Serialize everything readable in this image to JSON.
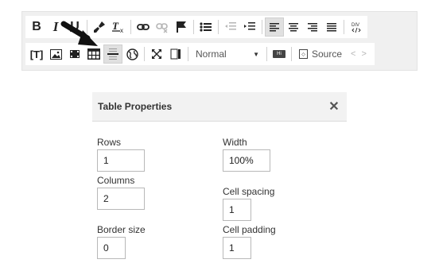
{
  "toolbar": {
    "row1": {
      "bold": "B",
      "italic": "I",
      "underline": "U",
      "remove_format": "Tx",
      "div_icon_text": "DIV"
    },
    "row2": {
      "text_field": "[T]",
      "format_select": "Normal",
      "source_label": "Source",
      "angle_brackets": "< >",
      "hi_badge": "Hi"
    }
  },
  "dialog": {
    "title": "Table Properties",
    "close": "✕",
    "rows_label": "Rows",
    "rows_value": "1",
    "columns_label": "Columns",
    "columns_value": "2",
    "border_label": "Border size",
    "border_value": "0",
    "width_label": "Width",
    "width_value": "100%",
    "spacing_label": "Cell spacing",
    "spacing_value": "1",
    "padding_label": "Cell padding",
    "padding_value": "1"
  }
}
